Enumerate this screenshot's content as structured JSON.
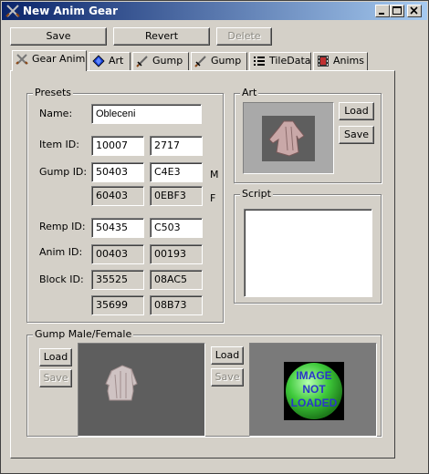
{
  "window": {
    "title": "New Anim Gear"
  },
  "toolbar": {
    "save": "Save",
    "revert": "Revert",
    "delete": "Delete"
  },
  "tabs": [
    {
      "label": "Gear Anim",
      "icon": "crossed-swords-icon"
    },
    {
      "label": "Art",
      "icon": "blue-gem-icon"
    },
    {
      "label": "Gump",
      "icon": "sword-icon"
    },
    {
      "label": "Gump",
      "icon": "sword-icon"
    },
    {
      "label": "TileData",
      "icon": "list-icon"
    },
    {
      "label": "Anims",
      "icon": "film-icon"
    }
  ],
  "presets": {
    "title": "Presets",
    "name_label": "Name:",
    "name_value": "Obleceni",
    "item_id_label": "Item ID:",
    "item_id": [
      "10007",
      "2717"
    ],
    "gump_id_label": "Gump ID:",
    "gump_id_m": [
      "50403",
      "C4E3"
    ],
    "gump_id_f": [
      "60403",
      "0EBF3"
    ],
    "m_label": "M",
    "f_label": "F",
    "remp_id_label": "Remp ID:",
    "remp_id": [
      "50435",
      "C503"
    ],
    "anim_id_label": "Anim ID:",
    "anim_id": [
      "00403",
      "00193"
    ],
    "block_id_label": "Block ID:",
    "block_id_1": [
      "35525",
      "08AC5"
    ],
    "block_id_2": [
      "35699",
      "08B73"
    ]
  },
  "art": {
    "title": "Art",
    "load": "Load",
    "save": "Save"
  },
  "script": {
    "title": "Script",
    "value": ""
  },
  "gump_mf": {
    "title": "Gump Male/Female",
    "male_load": "Load",
    "male_save": "Save",
    "female_load": "Load",
    "female_save": "Save",
    "image_not_loaded": [
      "IMAGE",
      "NOT",
      "LOADED"
    ]
  }
}
